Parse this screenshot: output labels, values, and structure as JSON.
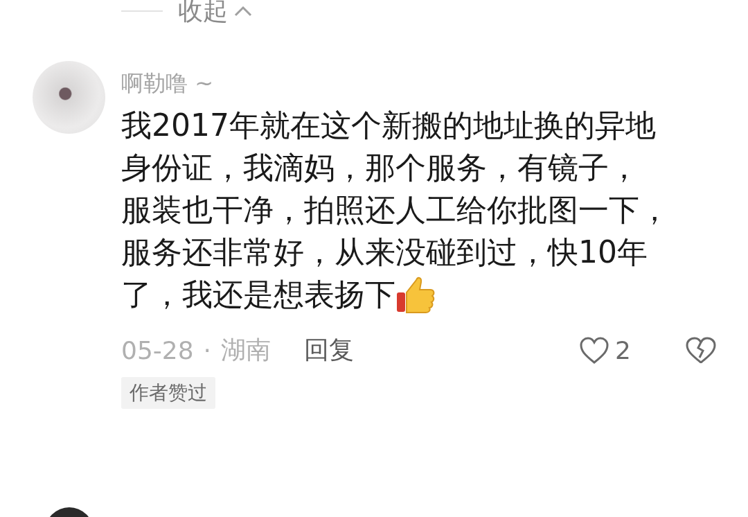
{
  "collapse": {
    "label": "收起"
  },
  "comment": {
    "username": "啊勒噜 ~",
    "body_lines": [
      "我2017年就在这个新搬的地址换的异地",
      "身份证，我滴妈，那个服务，有镜子，",
      "服装也干净，拍照还人工给你批图一下，",
      "服务还非常好，从来没碰到过，快10年",
      "了，我还是想表扬下"
    ],
    "date": "05-28",
    "separator": "·",
    "location": "湖南",
    "reply": "回复",
    "likes": "2",
    "liked": false,
    "tag": "作者赞过"
  }
}
